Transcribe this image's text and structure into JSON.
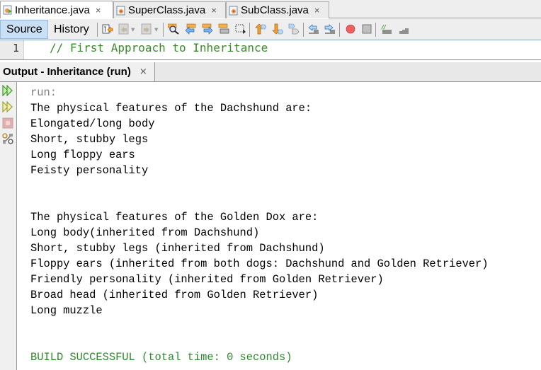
{
  "editor_tabs": [
    {
      "label": "Inheritance.java",
      "icon": "java-main-class-icon",
      "active": true
    },
    {
      "label": "SuperClass.java",
      "icon": "java-class-icon",
      "active": false
    },
    {
      "label": "SubClass.java",
      "icon": "java-class-icon",
      "active": false
    }
  ],
  "tab_close_glyph": "×",
  "toolbar": {
    "source_label": "Source",
    "history_label": "History",
    "icons": [
      "last-edit-icon",
      "back-icon",
      "forward-icon",
      "find-icon",
      "find-previous-icon",
      "find-next-icon",
      "toggle-highlight-icon",
      "rectangle-select-icon",
      "previous-bookmark-icon",
      "next-bookmark-icon",
      "toggle-bookmark-icon",
      "shift-left-icon",
      "shift-right-icon",
      "start-macro-icon",
      "stop-macro-icon",
      "comment-icon",
      "uncomment-icon"
    ]
  },
  "editor": {
    "line_number": "1",
    "code": "// First Approach to Inheritance"
  },
  "output": {
    "tab_title": "Output - Inheritance (run)",
    "side_icons": [
      "rerun-icon",
      "rerun-with-params-icon",
      "stop-icon",
      "settings-icon"
    ],
    "run_label": "run:",
    "lines": [
      "The physical features of the Dachshund are:",
      "Elongated/long body",
      "Short, stubby legs",
      "Long floppy ears",
      "Feisty personality",
      "",
      "",
      "The physical features of the Golden Dox are:",
      "Long body(inherited from Dachshund)",
      "Short, stubby legs (inherited from Dachshund)",
      "Floppy ears (inherited from both dogs: Dachshund and Golden Retriever)",
      "Friendly personality (inherited from Golden Retriever)",
      "Broad head (inherited from Golden Retriever)",
      "Long muzzle",
      "",
      ""
    ],
    "build_status": "BUILD SUCCESSFUL (total time: 0 seconds)"
  },
  "colors": {
    "comment_green": "#3a8a2d",
    "success_green": "#2a8a2a",
    "run_gray": "#808080",
    "active_view_bg": "#c9dff3"
  }
}
